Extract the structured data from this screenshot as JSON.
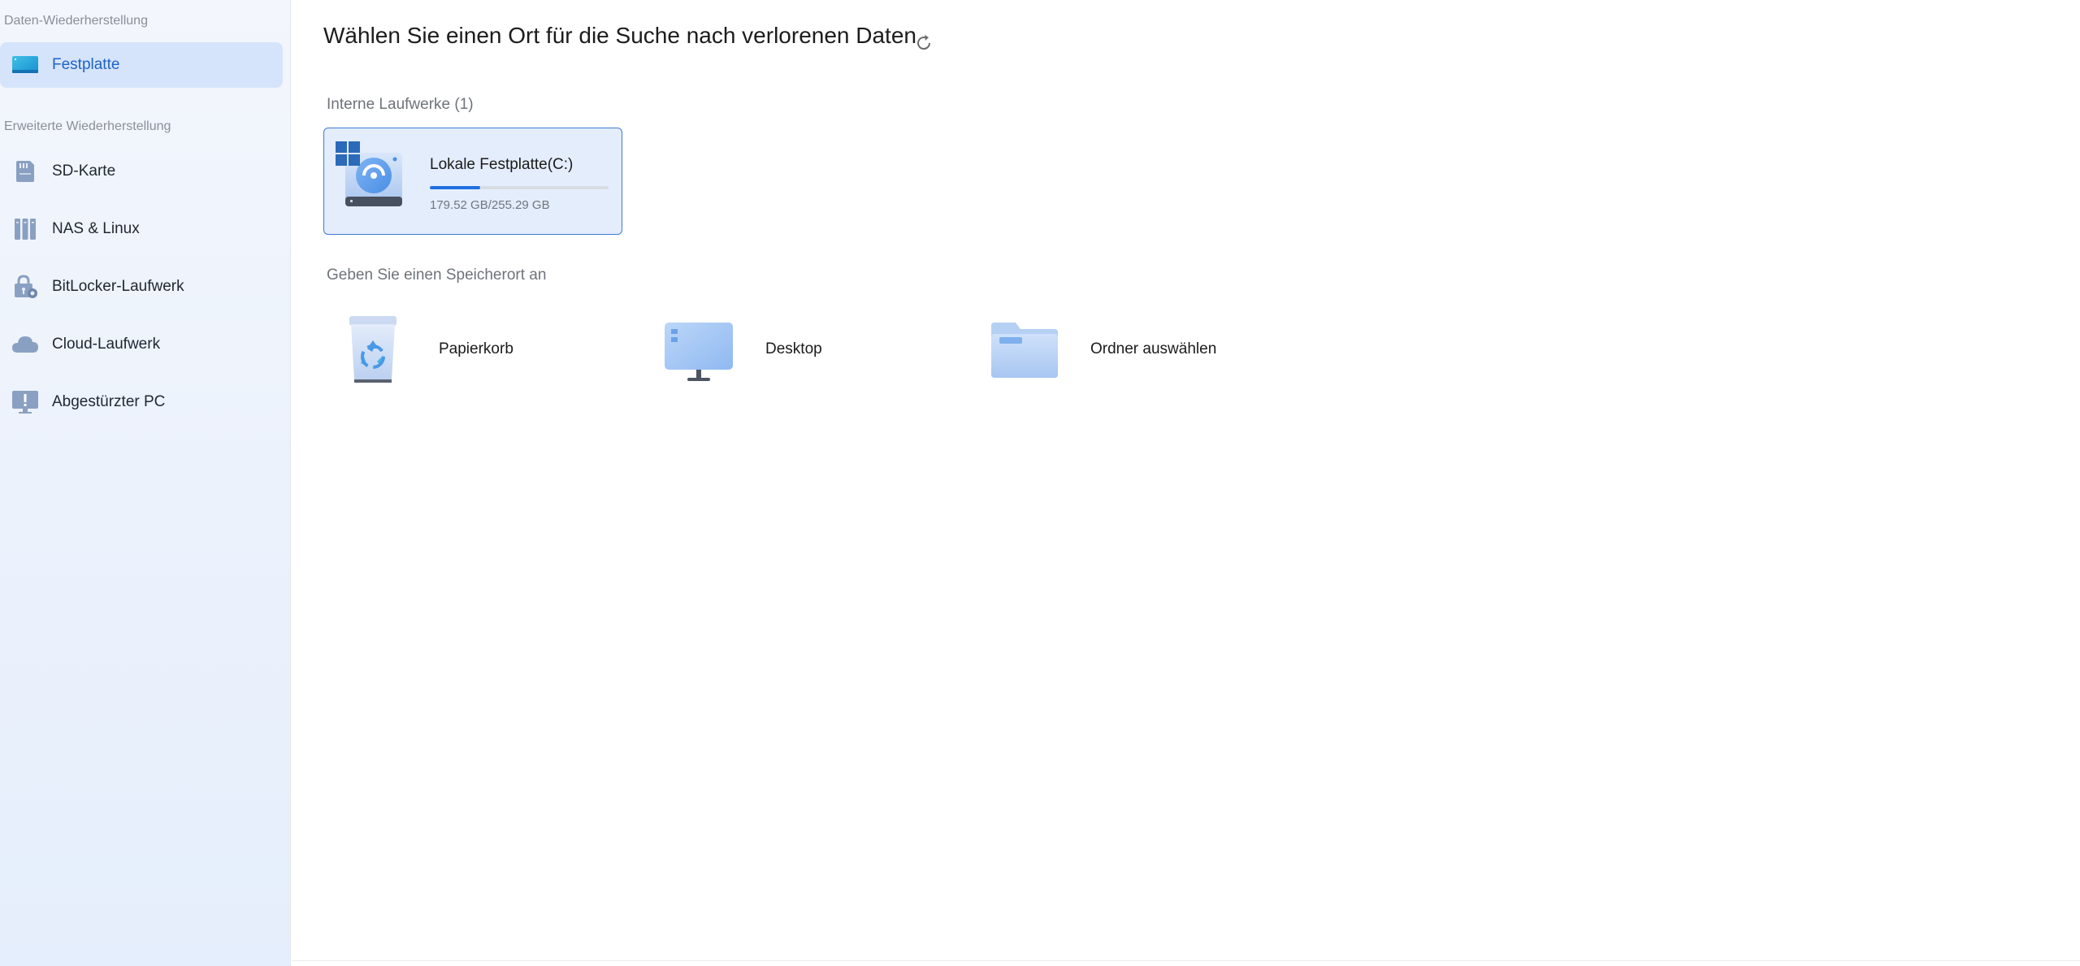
{
  "sidebar": {
    "section_data_recovery": "Daten-Wiederherstellung",
    "section_advanced_recovery": "Erweiterte Wiederherstellung",
    "items": [
      {
        "label": "Festplatte",
        "icon": "hard-disk-icon",
        "active": true
      },
      {
        "label": "SD-Karte",
        "icon": "sd-card-icon",
        "active": false
      },
      {
        "label": "NAS & Linux",
        "icon": "nas-icon",
        "active": false
      },
      {
        "label": "BitLocker-Laufwerk",
        "icon": "bitlocker-lock-icon",
        "active": false
      },
      {
        "label": "Cloud-Laufwerk",
        "icon": "cloud-icon",
        "active": false
      },
      {
        "label": "Abgestürzter PC",
        "icon": "crashed-pc-icon",
        "active": false
      }
    ]
  },
  "main": {
    "title": "Wählen Sie einen Ort für die Suche nach verlorenen Daten",
    "refresh_icon": "refresh-icon",
    "internal_drives_label": "Interne Laufwerke (1)",
    "drives": [
      {
        "name": "Lokale Festplatte(C:)",
        "size_text": "179.52 GB/255.29 GB",
        "used_fraction": 0.28,
        "icon": "windows-drive-icon"
      }
    ],
    "specify_location_label": "Geben Sie einen Speicherort an",
    "locations": [
      {
        "label": "Papierkorb",
        "icon": "recycle-bin-icon"
      },
      {
        "label": "Desktop",
        "icon": "desktop-monitor-icon"
      },
      {
        "label": "Ordner auswählen",
        "icon": "folder-icon"
      }
    ]
  },
  "colors": {
    "accent": "#1f6fe0",
    "active_bg": "#d6e4fb",
    "active_text": "#1e63c7",
    "card_bg": "#e4edfb",
    "card_border": "#3d7bd6"
  }
}
